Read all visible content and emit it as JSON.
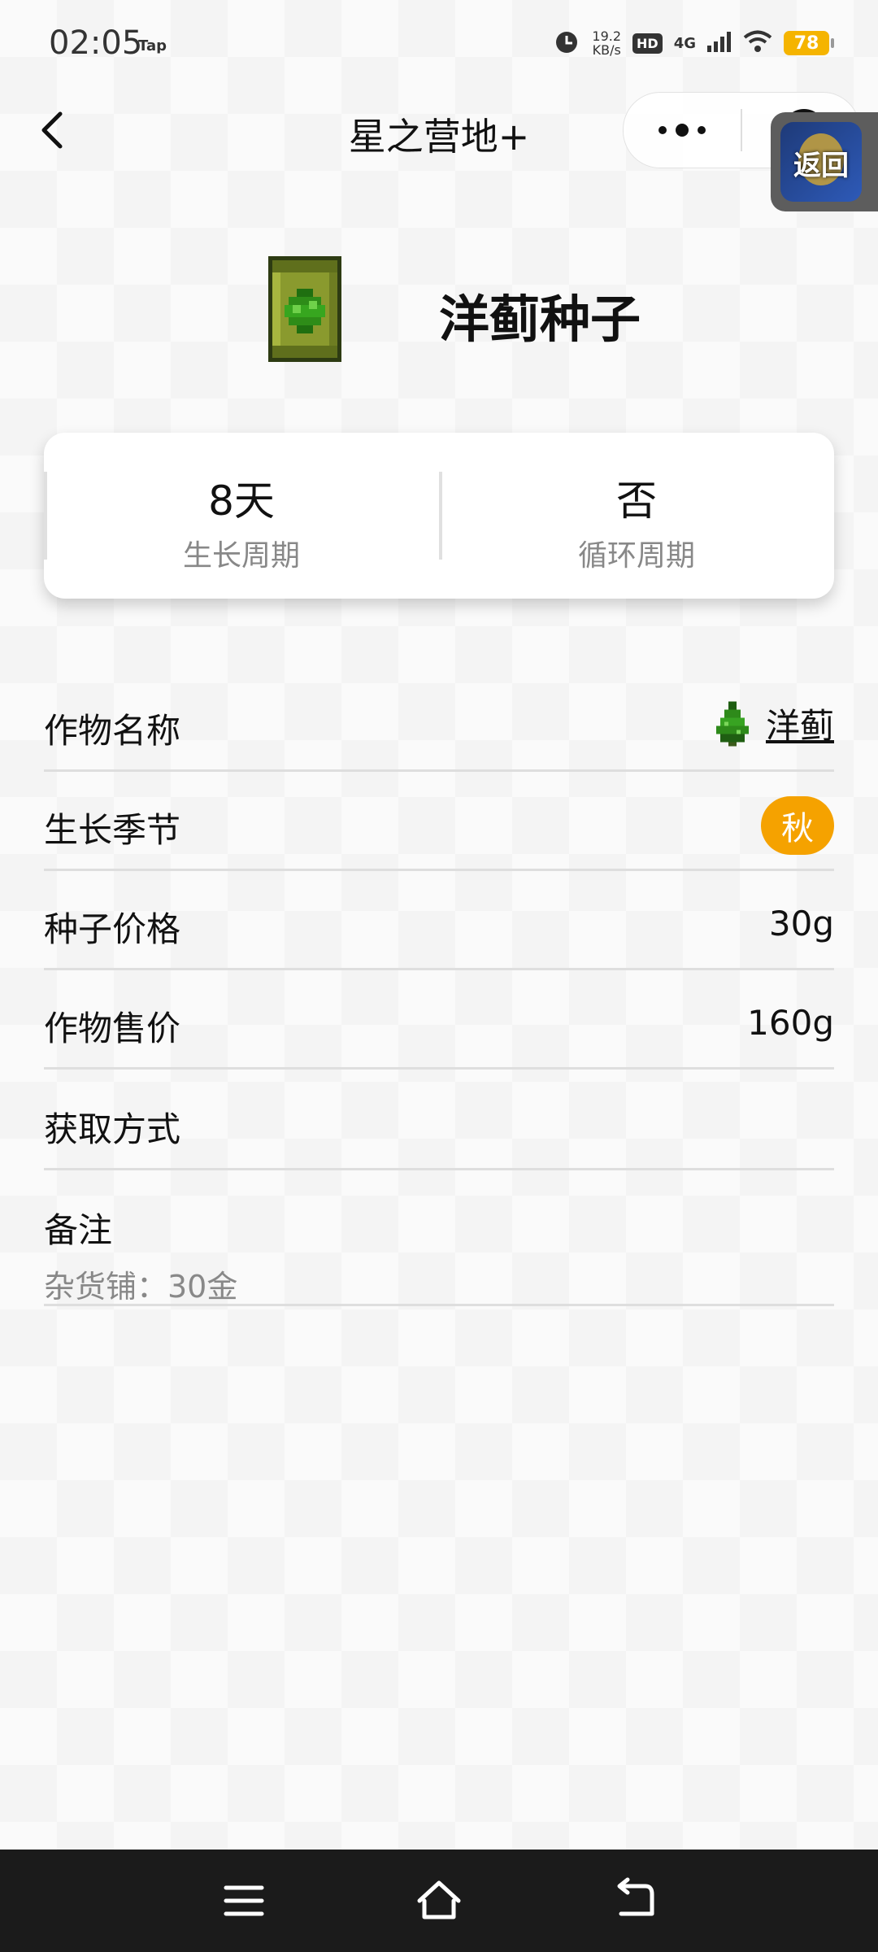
{
  "status_bar": {
    "time": "02:05",
    "tap": "Tap",
    "speed_value": "19.2",
    "speed_unit": "KB/s",
    "hd": "HD",
    "network": "4G",
    "battery": "78",
    "icons": [
      "alarm-icon",
      "wifi-icon",
      "signal-icon"
    ]
  },
  "nav": {
    "title": "星之营地+",
    "icons": [
      "back-icon",
      "more-icon",
      "close-icon"
    ]
  },
  "float_return": {
    "label": "返回"
  },
  "item": {
    "name": "洋蓟种子",
    "icon": "artichoke-seed-packet-icon"
  },
  "stats": [
    {
      "value": "8天",
      "label": "生长周期"
    },
    {
      "value": "否",
      "label": "循环周期"
    }
  ],
  "rows": {
    "crop_name": {
      "label": "作物名称",
      "value": "洋蓟",
      "icon": "artichoke-icon"
    },
    "season": {
      "label": "生长季节",
      "value": "秋",
      "color": "#f5a200"
    },
    "seed_price": {
      "label": "种子价格",
      "value": "30g"
    },
    "sell_price": {
      "label": "作物售价",
      "value": "160g"
    },
    "obtain": {
      "label": "获取方式"
    },
    "notes": {
      "label": "备注",
      "value": "杂货铺：30金"
    }
  },
  "bottom_nav": {
    "icons": [
      "menu-icon",
      "home-icon",
      "back-arrow-icon"
    ]
  }
}
